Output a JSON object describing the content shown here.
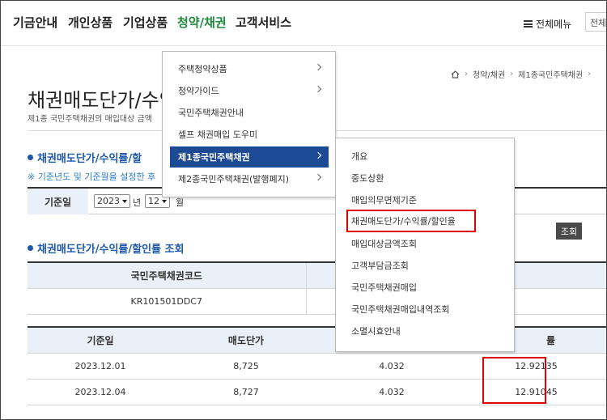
{
  "nav": {
    "items": [
      "기금안내",
      "개인상품",
      "기업상품",
      "청약/채권",
      "고객서비스"
    ],
    "menu_all": "전체메뉴",
    "search_text": "전체"
  },
  "breadcrumb": [
    "청약/채권",
    "제1종국민주택채권"
  ],
  "page": {
    "title": "채권매도단가/수익",
    "desc": "제1종 국민주택채권의 매입대상 금액"
  },
  "section1": {
    "title": "채권매도단가/수익률/할",
    "notice": "※ 기준년도 및 기준월을 설정한 후"
  },
  "base": {
    "label": "기준일",
    "year": "2023",
    "year_unit": "년",
    "month": "12",
    "month_unit": "월"
  },
  "query_button": "조회",
  "section2": {
    "title": "채권매도단가/수익률/할인률 조회"
  },
  "table1": {
    "header": "국민주택채권코드",
    "code": "KR101501DDC7"
  },
  "table2": {
    "headers": [
      "기준일",
      "매도단가",
      "",
      "률"
    ],
    "rows": [
      [
        "2023.12.01",
        "8,725",
        "4.032",
        "12.92135"
      ],
      [
        "2023.12.04",
        "8,727",
        "4.032",
        "12.91045"
      ]
    ]
  },
  "dropdown1": {
    "items": [
      "주택청약상품",
      "청약가이드",
      "국민주택채권안내",
      "셀프 채권매입 도우미",
      "제1종국민주택채권",
      "제2종국민주택채권(발행폐지)"
    ]
  },
  "dropdown2": {
    "items": [
      "개요",
      "중도상환",
      "매입의무면제기준",
      "채권매도단가/수익률/할인율",
      "매입대상금액조회",
      "고객부담금조회",
      "국민주택채권매입",
      "국민주택채권매입내역조회",
      "소멸시효안내"
    ]
  }
}
